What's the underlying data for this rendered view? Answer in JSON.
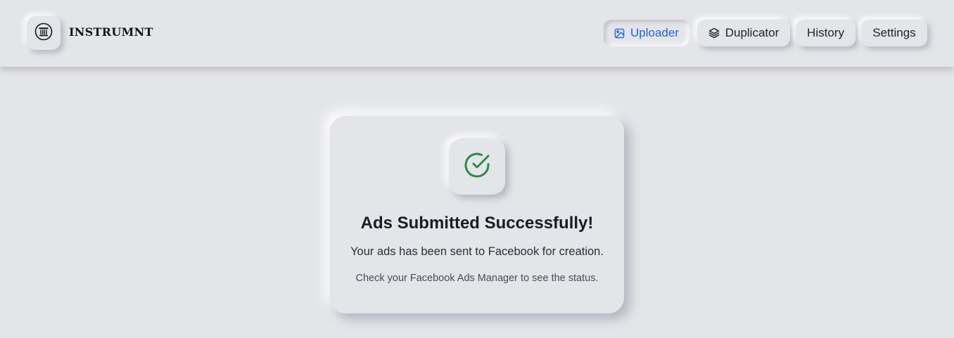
{
  "header": {
    "brand": "INSTRUMNT",
    "logo_icon": "pillar-logo-icon"
  },
  "nav": {
    "uploader": {
      "label": "Uploader",
      "icon": "image-upload-icon",
      "active": true
    },
    "duplicator": {
      "label": "Duplicator",
      "icon": "layers-icon",
      "active": false
    },
    "history": {
      "label": "History",
      "active": false
    },
    "settings": {
      "label": "Settings",
      "active": false
    }
  },
  "success_card": {
    "icon": "check-circle-icon",
    "title": "Ads Submitted Successfully!",
    "message": "Your ads has been sent to Facebook for creation.",
    "subtext": "Check your Facebook Ads Manager to see the status."
  },
  "colors": {
    "background": "#e4e5e9",
    "active_nav": "#2563d8",
    "success_green": "#2e8b45"
  }
}
